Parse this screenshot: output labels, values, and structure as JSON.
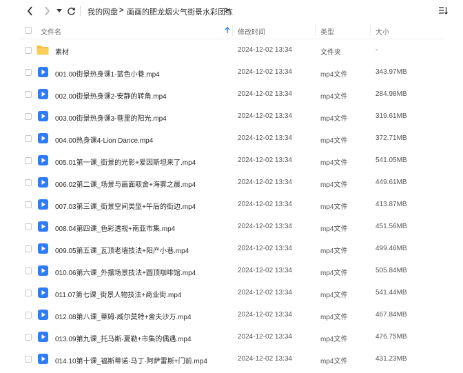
{
  "toolbar": {
    "breadcrumbs": [
      "我的网盘",
      "画画的肥龙烟火气街景水彩团练"
    ]
  },
  "columns": {
    "name": "文件名",
    "modified": "修改时间",
    "type": "类型",
    "size": "大小"
  },
  "files": [
    {
      "name": "素材",
      "date": "2024-12-02 13:34",
      "type": "文件夹",
      "size": "-",
      "icon": "folder-icon"
    },
    {
      "name": "001.00街景热身课1-蓝色小巷.mp4",
      "date": "2024-12-02 13:34",
      "type": "mp4文件",
      "size": "343.97MB",
      "icon": "video-file-icon"
    },
    {
      "name": "002.00街景热身课2-安静的转角.mp4",
      "date": "2024-12-02 13:34",
      "type": "mp4文件",
      "size": "284.98MB",
      "icon": "video-file-icon"
    },
    {
      "name": "003.00街景热身课3-巷里的阳光.mp4",
      "date": "2024-12-02 13:34",
      "type": "mp4文件",
      "size": "319.61MB",
      "icon": "video-file-icon"
    },
    {
      "name": "004.00热身课4-Lion Dance.mp4",
      "date": "2024-12-02 13:34",
      "type": "mp4文件",
      "size": "372.71MB",
      "icon": "video-file-icon"
    },
    {
      "name": "005.01第一课_街景的光影+爱因斯坦来了.mp4",
      "date": "2024-12-02 13:34",
      "type": "mp4文件",
      "size": "541.05MB",
      "icon": "video-file-icon"
    },
    {
      "name": "006.02第二课_场景与画面取舍+海雾之晨.mp4",
      "date": "2024-12-02 13:34",
      "type": "mp4文件",
      "size": "449.61MB",
      "icon": "video-file-icon"
    },
    {
      "name": "007.03第三课_街景空间类型+午后的街边.mp4",
      "date": "2024-12-02 13:34",
      "type": "mp4文件",
      "size": "413.87MB",
      "icon": "video-file-icon"
    },
    {
      "name": "008.04第四课_色彩透视+南亚市集.mp4",
      "date": "2024-12-02 13:34",
      "type": "mp4文件",
      "size": "451.56MB",
      "icon": "video-file-icon"
    },
    {
      "name": "009.05第五课_瓦顶老墙技法+阳产小巷.mp4",
      "date": "2024-12-02 13:34",
      "type": "mp4文件",
      "size": "499.46MB",
      "icon": "video-file-icon"
    },
    {
      "name": "010.06第六课_外摆场景技法+圆顶咖啡馆.mp4",
      "date": "2024-12-02 13:34",
      "type": "mp4文件",
      "size": "505.84MB",
      "icon": "video-file-icon"
    },
    {
      "name": "011.07第七课_街景人物技法+商业街.mp4",
      "date": "2024-12-02 13:34",
      "type": "mp4文件",
      "size": "541.44MB",
      "icon": "video-file-icon"
    },
    {
      "name": "012.08第八课_蒂姆·威尔莫特+舍夫沙万.mp4",
      "date": "2024-12-02 13:34",
      "type": "mp4文件",
      "size": "467.84MB",
      "icon": "video-file-icon"
    },
    {
      "name": "013.09第九课_托马斯·夏勒+市集的偶遇.mp4",
      "date": "2024-12-02 13:34",
      "type": "mp4文件",
      "size": "476.75MB",
      "icon": "video-file-icon"
    },
    {
      "name": "014.10第十课_福斯蒂诺·马丁·阿萨雷斯+门前.mp4",
      "date": "2024-12-02 13:34",
      "type": "mp4文件",
      "size": "431.23MB",
      "icon": "video-file-icon"
    }
  ],
  "colors": {
    "accent": "#2f7cf6",
    "folder": "#f7c03d"
  }
}
